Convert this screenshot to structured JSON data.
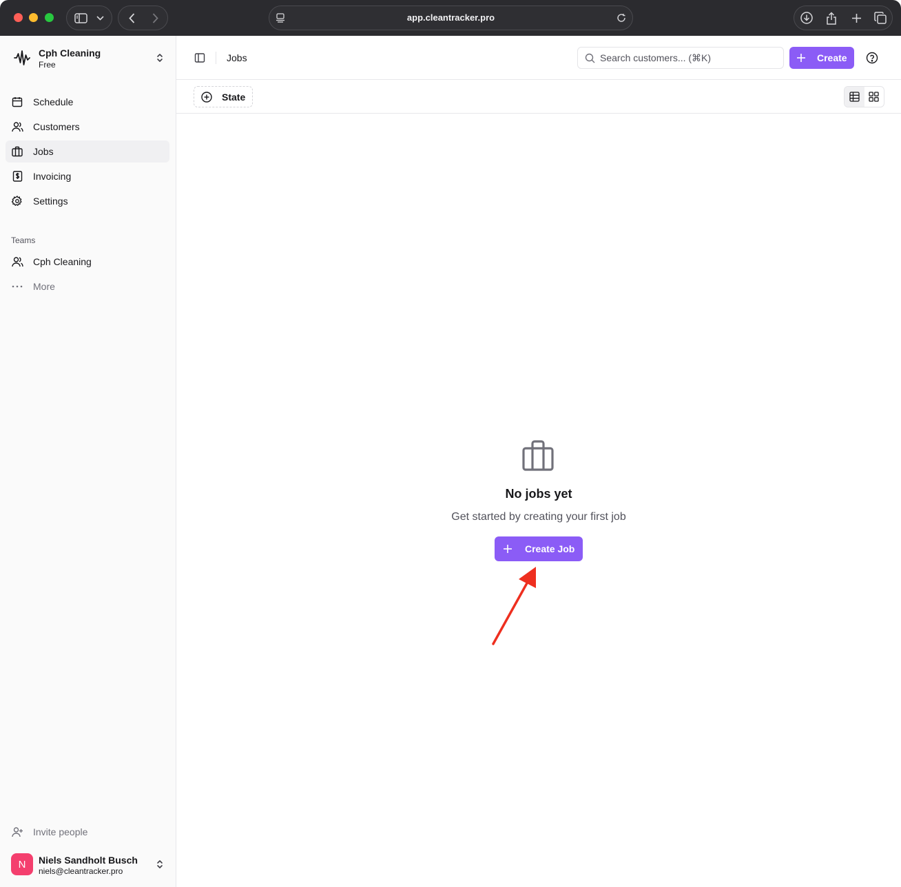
{
  "browser": {
    "url": "app.cleantracker.pro"
  },
  "workspace": {
    "name": "Cph Cleaning",
    "plan": "Free"
  },
  "nav": {
    "items": [
      {
        "label": "Schedule",
        "icon": "calendar-icon"
      },
      {
        "label": "Customers",
        "icon": "users-icon"
      },
      {
        "label": "Jobs",
        "icon": "briefcase-icon",
        "active": true
      },
      {
        "label": "Invoicing",
        "icon": "invoice-icon"
      },
      {
        "label": "Settings",
        "icon": "gear-icon"
      }
    ]
  },
  "teams": {
    "label": "Teams",
    "items": [
      {
        "label": "Cph Cleaning",
        "icon": "users-icon"
      },
      {
        "label": "More",
        "icon": "more-icon"
      }
    ]
  },
  "footer": {
    "invite_label": "Invite people",
    "user": {
      "initial": "N",
      "name": "Niels Sandholt Busch",
      "email": "niels@cleantracker.pro"
    }
  },
  "header": {
    "breadcrumb": "Jobs",
    "search_placeholder": "Search customers... (⌘K)",
    "create_label": "Create"
  },
  "filters": {
    "state_label": "State"
  },
  "empty_state": {
    "title": "No jobs yet",
    "subtitle": "Get started by creating your first job",
    "cta_label": "Create Job"
  },
  "colors": {
    "accent": "#8b5cf6",
    "annotation_arrow": "#ee2f1f",
    "avatar": "#f43f6e"
  }
}
